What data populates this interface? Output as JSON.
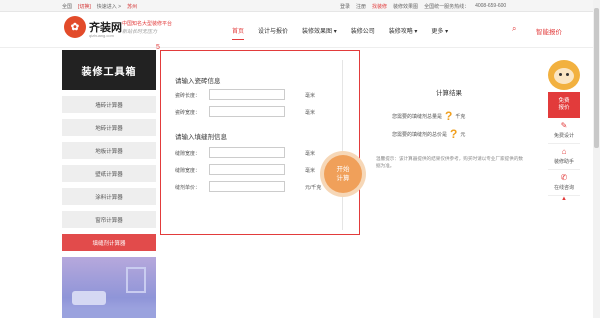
{
  "topbar": {
    "region_prefix": "全国",
    "region_switch": "[切换]",
    "quick_enter": "快速进入 >",
    "city": "苏州",
    "login": "登录",
    "register": "注册",
    "decorate": "找装修",
    "effect": "装修效果图",
    "hotline_label": "全国统一服务热线：",
    "hotline": "4008-659-600"
  },
  "header": {
    "logo_name": "齐装网",
    "logo_domain": "qizhuang.com",
    "slogan": "中国知名大型装修平台",
    "slogan_sub": "新站长时无压力"
  },
  "nav": {
    "items": [
      "首页",
      "设计与报价",
      "装修效果图 ▾",
      "装修公司",
      "装修攻略 ▾",
      "更多 ▾"
    ],
    "quote": "智能报价"
  },
  "sidebar": {
    "title": "装修工具箱",
    "items": [
      {
        "label": "墙砖计算器",
        "active": false
      },
      {
        "label": "地砖计算器",
        "active": false
      },
      {
        "label": "地板计算器",
        "active": false
      },
      {
        "label": "壁纸计算器",
        "active": false
      },
      {
        "label": "涂料计算器",
        "active": false
      },
      {
        "label": "窗帘计算器",
        "active": false
      },
      {
        "label": "填缝剂计算器",
        "active": true
      }
    ]
  },
  "calculator": {
    "step": "5",
    "section1_title": "请输入瓷砖信息",
    "fields1": [
      {
        "label": "瓷砖长度：",
        "value": "",
        "unit": "毫米"
      },
      {
        "label": "瓷砖宽度：",
        "value": "",
        "unit": "毫米"
      }
    ],
    "section2_title": "请输入填缝剂信息",
    "fields2": [
      {
        "label": "缝隙宽度：",
        "value": "",
        "unit": "毫米"
      },
      {
        "label": "缝隙宽度：",
        "value": "",
        "unit": "毫米"
      },
      {
        "label": "缝剂单价：",
        "value": "",
        "unit": "元/千克"
      }
    ],
    "start_line1": "开始",
    "start_line2": "计算"
  },
  "results": {
    "title": "计算结果",
    "row1_label": "您需要的填缝剂总量是",
    "row1_value": "?",
    "row1_unit": "千克",
    "row2_label": "您需要的填缝剂的总价是",
    "row2_value": "?",
    "row2_unit": "元",
    "tip": "温馨提示：该计算器提供的结果仅供参考，购买时请以专业厂家提供的数据为准。"
  },
  "float": {
    "free_line1": "免费",
    "free_line2": "报价",
    "items": [
      {
        "icon": "pencil-ruler-icon",
        "glyph": "✎",
        "label": "免费设计"
      },
      {
        "icon": "house-icon",
        "glyph": "⌂",
        "label": "装修助手"
      },
      {
        "icon": "chat-icon",
        "glyph": "✆",
        "label": "在线咨询"
      }
    ],
    "top": "▲"
  },
  "colors": {
    "accent": "#e23b3b",
    "start_button": "#f0a05a",
    "sidebar_title_bg": "#222222"
  }
}
